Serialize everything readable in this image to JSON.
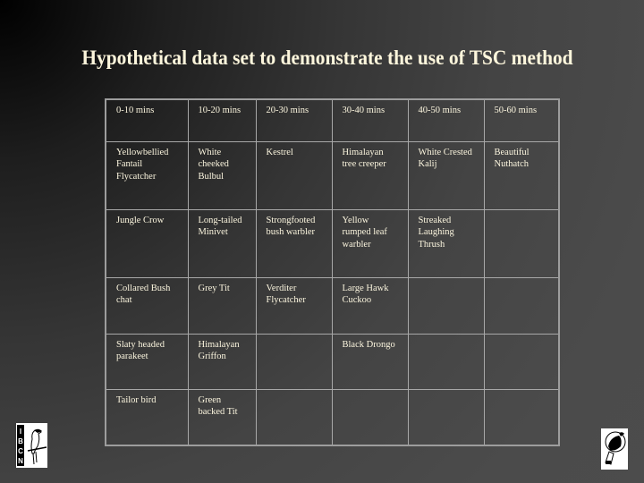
{
  "slide": {
    "title": "Hypothetical data set to demonstrate the use of TSC method"
  },
  "table": {
    "headers": [
      "0-10 mins",
      "10-20 mins",
      "20-30 mins",
      "30-40 mins",
      "40-50 mins",
      "50-60 mins"
    ],
    "rows": [
      [
        "Yellowbellied Fantail Flycatcher",
        "White cheeked Bulbul",
        "Kestrel",
        "Himalayan tree creeper",
        "White Crested Kalij",
        "Beautiful Nuthatch"
      ],
      [
        "Jungle Crow",
        "Long-tailed Minivet",
        "Strongfooted bush warbler",
        "Yellow rumped leaf warbler",
        "Streaked Laughing Thrush",
        ""
      ],
      [
        "Collared Bush chat",
        "Grey Tit",
        "Verditer Flycatcher",
        "Large Hawk Cuckoo",
        "",
        ""
      ],
      [
        "Slaty headed parakeet",
        "Himalayan Griffon",
        "",
        "Black Drongo",
        "",
        ""
      ],
      [
        "Tailor bird",
        "Green backed Tit",
        "",
        "",
        "",
        ""
      ]
    ]
  },
  "logos": {
    "left": {
      "icon": "ibcn-bird-logo-icon",
      "text": "IBCN"
    },
    "right": {
      "icon": "hornbill-logo-icon"
    }
  },
  "colors": {
    "text": "#fbf5de",
    "grid": "#a8a8a8"
  }
}
